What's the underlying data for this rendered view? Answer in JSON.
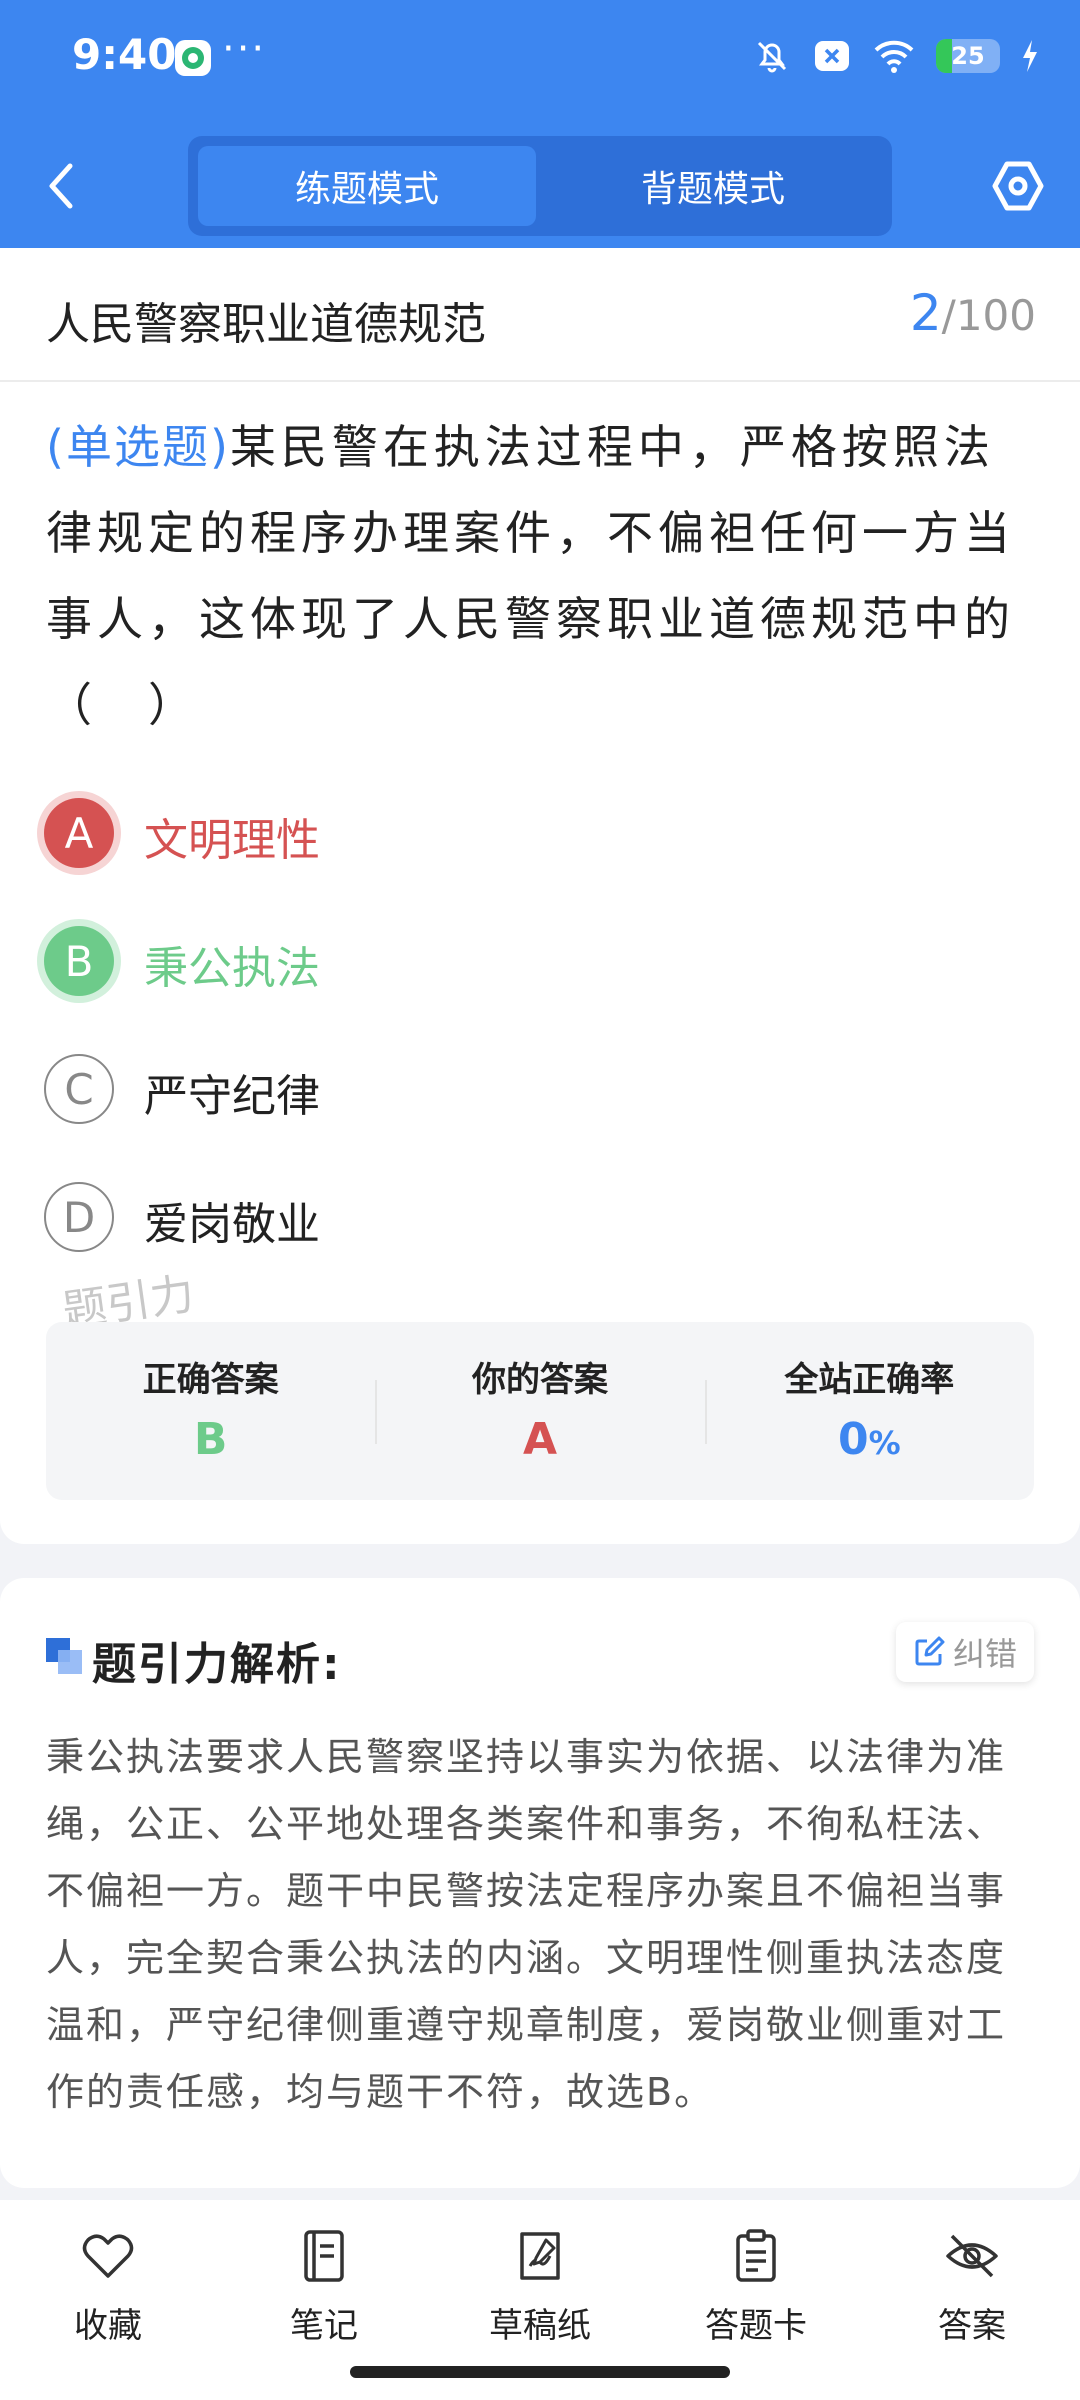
{
  "status_bar": {
    "time": "9:40",
    "dots": "···",
    "battery_level": "25",
    "battery_fraction": 0.25,
    "icons": [
      "app-icon",
      "bell-off-icon",
      "notification-x-icon",
      "wifi-icon",
      "battery-icon",
      "charging-icon"
    ]
  },
  "header": {
    "back_icon": "chevron-left-icon",
    "tabs": [
      {
        "label": "练题模式",
        "active": true
      },
      {
        "label": "背题模式",
        "active": false
      }
    ],
    "settings_icon": "settings-hexagon-icon",
    "colors": {
      "primary": "#3d86f0",
      "switch_bg": "#2e6fd8"
    }
  },
  "question_card": {
    "chapter_title": "人民警察职业道德规范",
    "current": "2",
    "total": "/100",
    "question_type": "(单选题)",
    "question_text": "某民警在执法过程中，严格按照法律规定的程序办理案件，不偏袒任何一方当事人，这体现了人民警察职业道德规范中的（　）",
    "options": [
      {
        "letter": "A",
        "text": "文明理性",
        "state": "wrong"
      },
      {
        "letter": "B",
        "text": "秉公执法",
        "state": "correct"
      },
      {
        "letter": "C",
        "text": "严守纪律",
        "state": "normal"
      },
      {
        "letter": "D",
        "text": "爱岗敬业",
        "state": "normal"
      }
    ],
    "watermark": "题引力",
    "stats": {
      "correct_label": "正确答案",
      "correct_value": "B",
      "yours_label": "你的答案",
      "yours_value": "A",
      "rate_label": "全站正确率",
      "rate_value": "0",
      "rate_unit": "%"
    },
    "colors": {
      "correct": "#6dcb8a",
      "wrong": "#d55252"
    }
  },
  "analysis": {
    "title": "题引力解析:",
    "report_label": "纠错",
    "text": "秉公执法要求人民警察坚持以事实为依据、以法律为准绳，公正、公平地处理各类案件和事务，不徇私枉法、不偏袒一方。题干中民警按法定程序办案且不偏袒当事人，完全契合秉公执法的内涵。文明理性侧重执法态度温和，严守纪律侧重遵守规章制度，爱岗敬业侧重对工作的责任感，均与题干不符，故选B。"
  },
  "tabbar": {
    "items": [
      {
        "label": "收藏",
        "icon": "heart-icon"
      },
      {
        "label": "笔记",
        "icon": "notebook-icon"
      },
      {
        "label": "草稿纸",
        "icon": "draft-paper-icon"
      },
      {
        "label": "答题卡",
        "icon": "answer-card-icon"
      },
      {
        "label": "答案",
        "icon": "eye-off-icon"
      }
    ]
  }
}
